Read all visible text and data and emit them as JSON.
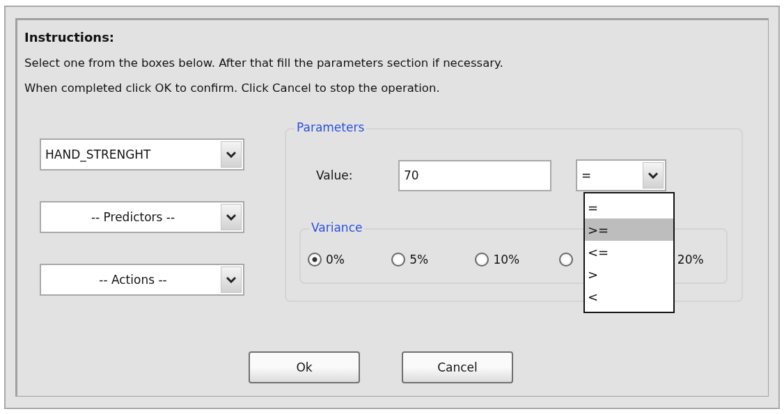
{
  "instructions": {
    "title": "Instructions:",
    "lines": [
      "Select one from the boxes below. After that fill the parameters section if necessary.",
      "When completed click OK to confirm. Click Cancel to stop the operation."
    ]
  },
  "selectors": [
    {
      "value": "HAND_STRENGHT",
      "kind": "value"
    },
    {
      "value": "-- Predictors --",
      "kind": "placeholder"
    },
    {
      "value": "-- Actions --",
      "kind": "placeholder"
    }
  ],
  "parameters": {
    "legend": "Parameters",
    "value_label": "Value:",
    "value": "70",
    "operator": {
      "value": "=",
      "expanded": true,
      "options": [
        {
          "label": "=",
          "highlighted": false
        },
        {
          "label": ">=",
          "highlighted": true
        },
        {
          "label": "<=",
          "highlighted": false
        },
        {
          "label": ">",
          "highlighted": false
        },
        {
          "label": "<",
          "highlighted": false
        }
      ]
    },
    "variance": {
      "legend": "Variance",
      "options": [
        {
          "label": "0%",
          "selected": true
        },
        {
          "label": "5%",
          "selected": false
        },
        {
          "label": "10%",
          "selected": false
        },
        {
          "selected": false
        },
        {
          "label": "20%"
        }
      ]
    }
  },
  "buttons": [
    "Ok",
    "Cancel"
  ]
}
